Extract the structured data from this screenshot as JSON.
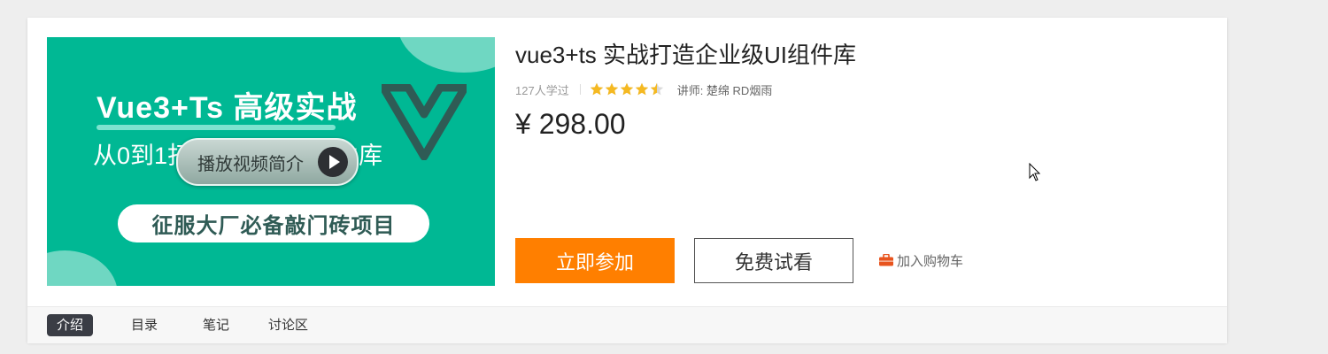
{
  "cover": {
    "headline": "Vue3+Ts 高级实战",
    "subline": "从0到1打造企业级UI组件库",
    "play_label": "播放视频简介",
    "banner": "征服大厂必备敲门砖项目",
    "colors": {
      "bg": "#00b894",
      "accent": "#6fd7c2",
      "logo": "#2f5b55"
    }
  },
  "course": {
    "title": "vue3+ts 实战打造企业级UI组件库",
    "learners": "127人学过",
    "rating": 4.5,
    "teacher": "讲师: 楚绵 RD烟雨",
    "price": "¥ 298.00"
  },
  "actions": {
    "join_label": "立即参加",
    "trial_label": "免费试看",
    "cart_label": "加入购物车",
    "cart_icon": "briefcase-icon",
    "join_color": "#ff7f00",
    "cart_icon_color": "#e8541e"
  },
  "tabs": [
    {
      "label": "介绍",
      "active": true
    },
    {
      "label": "目录",
      "active": false
    },
    {
      "label": "笔记",
      "active": false
    },
    {
      "label": "讨论区",
      "active": false
    }
  ]
}
